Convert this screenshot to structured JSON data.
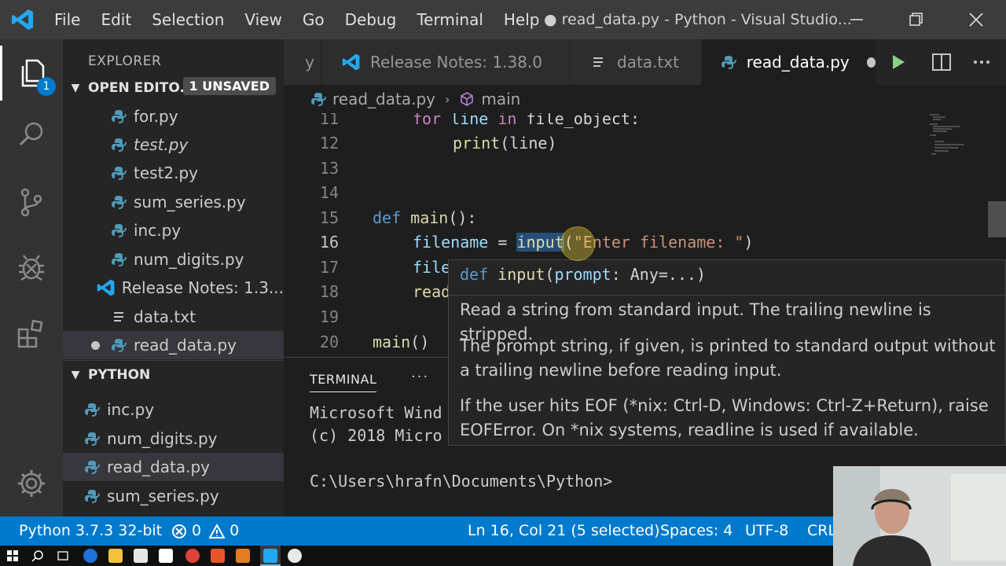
{
  "titlebar": {
    "menu": [
      "File",
      "Edit",
      "Selection",
      "View",
      "Go",
      "Debug",
      "Terminal",
      "Help"
    ],
    "title": "● read_data.py - Python - Visual Studio..."
  },
  "activity_bar": {
    "explorer_badge": "1"
  },
  "sidebar": {
    "title": "EXPLORER",
    "open_editors": {
      "label": "OPEN EDITO...",
      "badge": "1 UNSAVED",
      "items": [
        {
          "name": "for.py",
          "type": "python"
        },
        {
          "name": "test.py",
          "type": "python"
        },
        {
          "name": "test2.py",
          "type": "python"
        },
        {
          "name": "sum_series.py",
          "type": "python"
        },
        {
          "name": "inc.py",
          "type": "python"
        },
        {
          "name": "num_digits.py",
          "type": "python"
        },
        {
          "name": "Release Notes: 1.3...",
          "type": "vscode"
        },
        {
          "name": "data.txt",
          "type": "text"
        },
        {
          "name": "read_data.py",
          "type": "python"
        }
      ]
    },
    "python_folder": {
      "label": "PYTHON",
      "items": [
        "inc.py",
        "num_digits.py",
        "read_data.py",
        "sum_series.py"
      ]
    }
  },
  "tabs": [
    {
      "label": "y",
      "icon": "python-icon"
    },
    {
      "label": "Release Notes: 1.38.0",
      "icon": "vscode-icon"
    },
    {
      "label": "data.txt",
      "icon": "text-file-icon"
    },
    {
      "label": "read_data.py",
      "icon": "python-icon"
    }
  ],
  "breadcrumb": {
    "file": "read_data.py",
    "symbol": "main"
  },
  "editor": {
    "line_numbers": [
      "11",
      "12",
      "13",
      "14",
      "15",
      "16",
      "17",
      "18",
      "19",
      "20"
    ],
    "l11": {
      "kw1": "for",
      "v1": " line ",
      "kw2": "in",
      "rest": " file_object:"
    },
    "l12": {
      "fn": "print",
      "rest": "(line)"
    },
    "l15": {
      "kw": "def",
      "fn": "main",
      "rest": "():"
    },
    "l16": {
      "var": "filename",
      "eq": " = ",
      "fn": "input",
      "paren": "(",
      "str": "\"Enter filename: \"",
      "close": ")"
    },
    "l17": "file",
    "l18": "read",
    "l20": {
      "fn": "main",
      "rest": "()"
    }
  },
  "hover": {
    "sig_kw": "def",
    "sig_fn": "input",
    "sig_param": "prompt",
    "sig_rest": ": Any=...)",
    "doc1": "Read a string from standard input. The trailing newline is stripped.",
    "doc2": "The prompt string, if given, is printed to standard output without a trailing newline before reading input.",
    "doc3": "If the user hits EOF (*nix: Ctrl-D, Windows: Ctrl-Z+Return), raise EOFError. On *nix systems, readline is used if available."
  },
  "panel": {
    "tab": "TERMINAL",
    "more": "···",
    "lines": [
      "Microsoft Wind",
      "(c) 2018 Micro",
      "",
      "C:\\Users\\hrafn\\Documents\\Python>"
    ]
  },
  "statusbar": {
    "interpreter": "Python 3.7.3 32-bit",
    "errors": "0",
    "warnings": "0",
    "position": "Ln 16, Col 21 (5 selected)",
    "spaces": "Spaces: 4",
    "encoding": "UTF-8",
    "eol": "CRL"
  },
  "colors": {
    "accent": "#007acc",
    "titlebar": "#3c3c3c",
    "editor_bg": "#1e1e1e",
    "sidebar_bg": "#252526"
  }
}
